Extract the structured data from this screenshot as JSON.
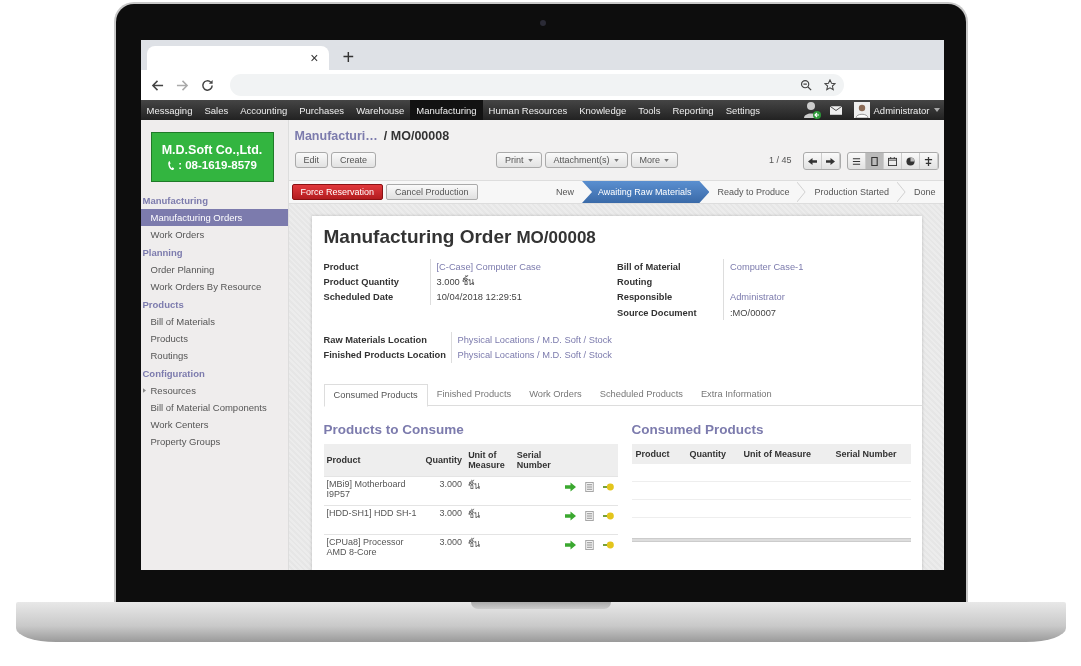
{
  "browser": {
    "tab_close": "×",
    "new_tab": "+"
  },
  "menu": [
    {
      "label": "Messaging",
      "selected": false
    },
    {
      "label": "Sales",
      "selected": false
    },
    {
      "label": "Accounting",
      "selected": false
    },
    {
      "label": "Purchases",
      "selected": false
    },
    {
      "label": "Warehouse",
      "selected": false
    },
    {
      "label": "Manufacturing",
      "selected": true
    },
    {
      "label": "Human Resources",
      "selected": false
    },
    {
      "label": "Knowledge",
      "selected": false
    },
    {
      "label": "Tools",
      "selected": false
    },
    {
      "label": "Reporting",
      "selected": false
    },
    {
      "label": "Settings",
      "selected": false
    }
  ],
  "user": "Administrator",
  "logo": {
    "company": "M.D.Soft Co.,Ltd.",
    "phone": ": 08-1619-8579"
  },
  "sidebar": [
    {
      "heading": "Manufacturing",
      "items": [
        {
          "label": "Manufacturing Orders",
          "selected": true,
          "kind": "link"
        },
        {
          "label": "Work Orders",
          "selected": false,
          "kind": "link"
        }
      ]
    },
    {
      "heading": "Planning",
      "items": [
        {
          "label": "Order Planning",
          "selected": false,
          "kind": "link"
        },
        {
          "label": "Work Orders By Resource",
          "selected": false,
          "kind": "link"
        }
      ]
    },
    {
      "heading": "Products",
      "items": [
        {
          "label": "Bill of Materials",
          "selected": false,
          "kind": "link"
        },
        {
          "label": "Products",
          "selected": false,
          "kind": "link"
        },
        {
          "label": "Routings",
          "selected": false,
          "kind": "link"
        }
      ]
    },
    {
      "heading": "Configuration",
      "items": [
        {
          "label": "Resources",
          "selected": false,
          "kind": "folder"
        },
        {
          "label": "Bill of Material Components",
          "selected": false,
          "kind": "link"
        },
        {
          "label": "Work Centers",
          "selected": false,
          "kind": "link"
        },
        {
          "label": "Property Groups",
          "selected": false,
          "kind": "link"
        }
      ]
    }
  ],
  "breadcrumb": {
    "parent": "Manufacturi…",
    "current": "/ MO/00008"
  },
  "buttons": [
    "Edit",
    "Create"
  ],
  "dropdowns": [
    "Print",
    "Attachment(s)",
    "More"
  ],
  "pager": "1 / 45",
  "views": [
    {
      "kind": "list",
      "selected": false
    },
    {
      "kind": "form",
      "selected": true
    },
    {
      "kind": "calendar",
      "selected": false
    },
    {
      "kind": "graph",
      "selected": false
    },
    {
      "kind": "gantt",
      "selected": false
    }
  ],
  "actions": [
    {
      "label": "Force Reservation",
      "kind": "primary"
    },
    {
      "label": "Cancel Production",
      "kind": "default"
    }
  ],
  "stages": [
    {
      "label": "New",
      "selected": false
    },
    {
      "label": "Awaiting Raw Materials",
      "selected": true
    },
    {
      "label": "Ready to Produce",
      "selected": false
    },
    {
      "label": "Production Started",
      "selected": false
    },
    {
      "label": "Done",
      "selected": false
    }
  ],
  "title": {
    "text": "Manufacturing Order",
    "number": "MO/00008"
  },
  "fields_left": [
    {
      "label": "Product",
      "value": "[C-Case] Computer Case",
      "kind": "link"
    },
    {
      "label": "Product Quantity",
      "value": "3.000 ชิ้น",
      "kind": "text"
    },
    {
      "label": "Scheduled Date",
      "value": "10/04/2018 12:29:51",
      "kind": "text"
    }
  ],
  "fields_right": [
    {
      "label": "Bill of Material",
      "value": "Computer Case-1",
      "kind": "link"
    },
    {
      "label": "Routing"
    },
    {
      "label": "Responsible",
      "value": "Administrator",
      "kind": "link"
    },
    {
      "label": "Source Document",
      "value": ":MO/00007",
      "kind": "text"
    }
  ],
  "locations": [
    {
      "label": "Raw Materials Location",
      "value": "Physical Locations / M.D. Soft / Stock"
    },
    {
      "label": "Finished Products Location",
      "value": "Physical Locations / M.D. Soft / Stock"
    }
  ],
  "tabs": [
    {
      "label": "Consumed Products",
      "selected": true
    },
    {
      "label": "Finished Products",
      "selected": false
    },
    {
      "label": "Work Orders",
      "selected": false
    },
    {
      "label": "Scheduled Products",
      "selected": false
    },
    {
      "label": "Extra Information",
      "selected": false
    }
  ],
  "to_consume": {
    "title": "Products to Consume",
    "columns": [
      "Product",
      "Quantity",
      "Unit of Measure",
      "Serial Number"
    ],
    "rows": [
      {
        "product": "[MBi9] Motherboard I9P57",
        "quantity": "3.000",
        "uom": "ชิ้น"
      },
      {
        "product": "[HDD-SH1] HDD SH-1",
        "quantity": "3.000",
        "uom": "ชิ้น"
      },
      {
        "product": "[CPUa8] Processor AMD 8-Core",
        "quantity": "3.000",
        "uom": "ชิ้น"
      }
    ]
  },
  "consumed": {
    "title": "Consumed Products",
    "columns": [
      "Product",
      "Quantity",
      "Unit of Measure",
      "Serial Number"
    ]
  }
}
